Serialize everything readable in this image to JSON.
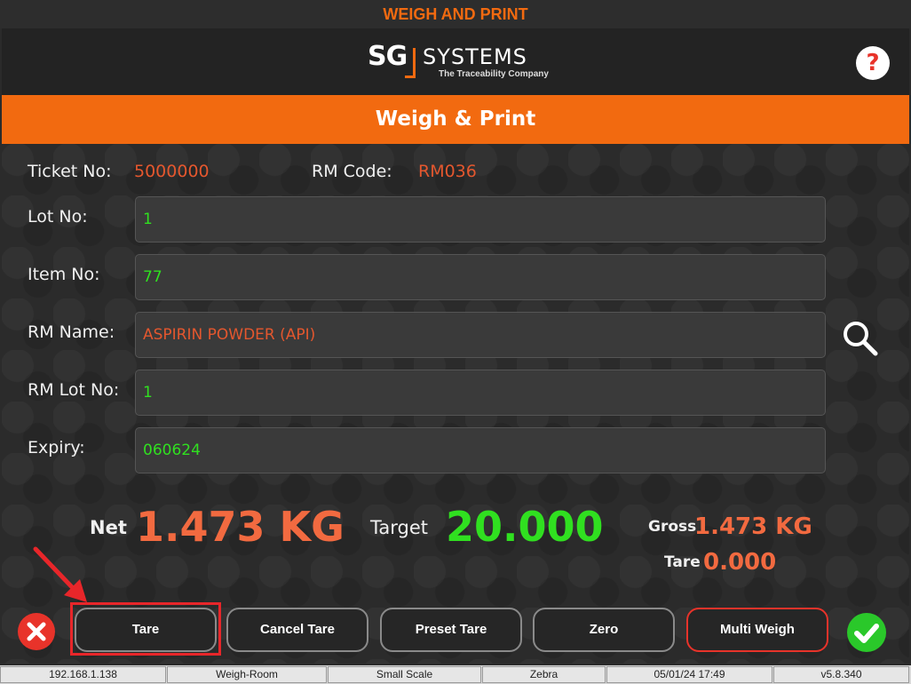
{
  "window": {
    "title": "WEIGH AND PRINT"
  },
  "header": {
    "logo": {
      "sg": "SG",
      "name": "SYSTEMS",
      "tagline": "The Traceability Company"
    },
    "help_label": "?"
  },
  "banner": {
    "title": "Weigh & Print"
  },
  "info": {
    "ticket_label": "Ticket No:",
    "ticket_value": "5000000",
    "rm_code_label": "RM Code:",
    "rm_code_value": "RM036"
  },
  "form": {
    "lot_no": {
      "label": "Lot No:",
      "value": "1"
    },
    "item_no": {
      "label": "Item No:",
      "value": "77"
    },
    "rm_name": {
      "label": "RM Name:",
      "value": "ASPIRIN POWDER (API)"
    },
    "rm_lot_no": {
      "label": "RM Lot No:",
      "value": "1"
    },
    "expiry": {
      "label": "Expiry:",
      "value": "060624"
    }
  },
  "weights": {
    "net_label": "Net",
    "net_value": "1.473 KG",
    "target_label": "Target",
    "target_value": "20.000",
    "gross_label": "Gross",
    "gross_value": "1.473 KG",
    "tare_label": "Tare",
    "tare_value": "0.000"
  },
  "buttons": {
    "tare": "Tare",
    "cancel_tare": "Cancel Tare",
    "preset_tare": "Preset Tare",
    "zero": "Zero",
    "multi_weigh": "Multi Weigh"
  },
  "statusbar": {
    "ip": "192.168.1.138",
    "location": "Weigh-Room",
    "scale": "Small Scale",
    "printer": "Zebra",
    "datetime": "05/01/24 17:49",
    "version": "v5.8.340"
  },
  "colors": {
    "accent": "#f26a10",
    "value_orange": "#e4572e",
    "value_green": "#30e020",
    "highlight_red": "#e8262a"
  }
}
